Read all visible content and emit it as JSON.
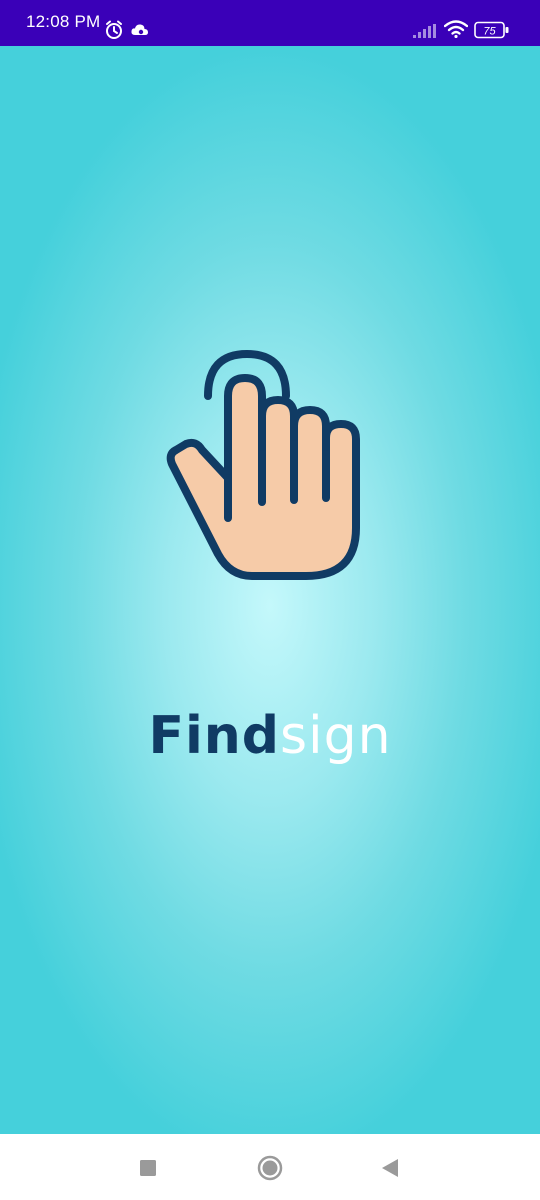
{
  "status_bar": {
    "time": "12:08 PM",
    "battery_level": "75",
    "icons": [
      "alarm-icon",
      "cloud-sync-icon",
      "cell-signal-icon",
      "wifi-icon",
      "battery-icon"
    ],
    "background": "#3a00b8"
  },
  "splash": {
    "brand_bold": "Find",
    "brand_light": "sign",
    "logo_icon": "pointing-hand-icon",
    "colors": {
      "brand_dark": "#103b64",
      "brand_light": "#ffffff",
      "hand_fill": "#f6cba8",
      "gradient_center": "#c4f8fb",
      "gradient_edge": "#45d0db"
    }
  },
  "nav_bar": {
    "icons": [
      "recents-square-icon",
      "home-circle-icon",
      "back-triangle-icon"
    ]
  }
}
